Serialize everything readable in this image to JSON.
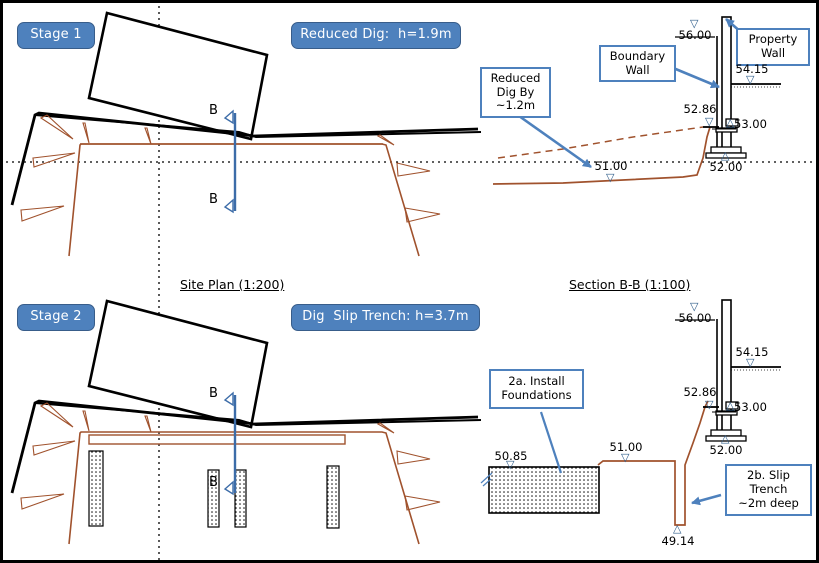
{
  "sheet": {
    "border_color": "#000000",
    "accent_blue": "#4e81bd",
    "earth_brown": "#a0522d",
    "line_black": "#000000"
  },
  "stage1": {
    "stage_badge": "Stage 1",
    "title_badge": "Reduced Dig:  h=1.9m",
    "section_marks": {
      "top": "B",
      "bottom": "B"
    },
    "callouts": [
      {
        "name": "reduced-dig-callout",
        "text": "Reduced\nDig By\n~1.2m"
      },
      {
        "name": "boundary-wall-callout",
        "text": "Boundary\nWall"
      },
      {
        "name": "property-wall-callout",
        "text": "Property\nWall"
      }
    ],
    "levels": [
      {
        "name": "level-56-00",
        "value": "56.00",
        "marker": "down"
      },
      {
        "name": "level-54-15",
        "value": "54.15",
        "marker": "down"
      },
      {
        "name": "level-52-86",
        "value": "52.86",
        "marker": "down"
      },
      {
        "name": "level-53-00",
        "value": "53.00",
        "marker": "up"
      },
      {
        "name": "level-52-00",
        "value": "52.00",
        "marker": "up"
      },
      {
        "name": "level-51-00",
        "value": "51.00",
        "marker": "down"
      }
    ]
  },
  "stage2": {
    "stage_badge": "Stage 2",
    "title_badge": "Dig  Slip Trench: h=3.7m",
    "section_marks": {
      "top": "B",
      "bottom": "B"
    },
    "callouts": [
      {
        "name": "install-foundations-callout",
        "text": "2a. Install\nFoundations"
      },
      {
        "name": "slip-trench-callout",
        "text": "2b. Slip\nTrench\n~2m deep"
      }
    ],
    "levels": [
      {
        "name": "level-56-00",
        "value": "56.00",
        "marker": "down"
      },
      {
        "name": "level-54-15",
        "value": "54.15",
        "marker": "down"
      },
      {
        "name": "level-52-86",
        "value": "52.86",
        "marker": "down"
      },
      {
        "name": "level-53-00",
        "value": "53.00",
        "marker": "up"
      },
      {
        "name": "level-52-00",
        "value": "52.00",
        "marker": "up"
      },
      {
        "name": "level-51-00",
        "value": "51.00",
        "marker": "down"
      },
      {
        "name": "level-50-85",
        "value": "50.85",
        "marker": "down"
      },
      {
        "name": "level-49-14",
        "value": "49.14",
        "marker": "up"
      }
    ]
  },
  "titles": {
    "site_plan": "Site Plan (1:200)",
    "section_bb": "Section B-B (1:100)"
  },
  "glyphs": {
    "triangle_down": "▽",
    "triangle_up": "△"
  }
}
